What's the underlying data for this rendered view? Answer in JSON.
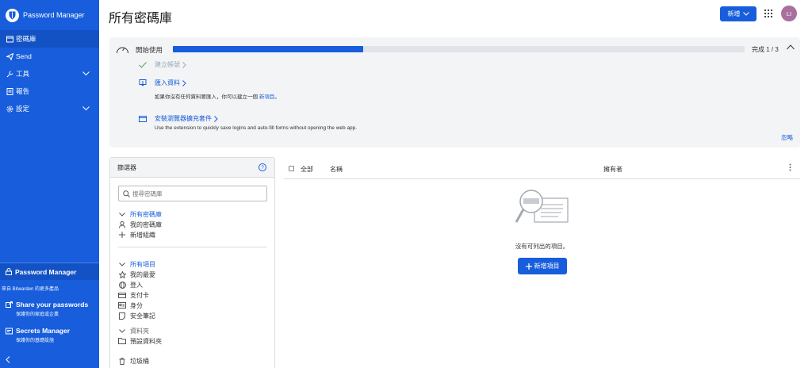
{
  "sidebar": {
    "brand": "Password Manager",
    "nav": [
      {
        "label": "密碼庫",
        "icon": "vault-icon",
        "active": true
      },
      {
        "label": "Send",
        "icon": "send-icon",
        "active": false
      },
      {
        "label": "工具",
        "icon": "wrench-icon",
        "has_children": true
      },
      {
        "label": "報告",
        "icon": "report-icon",
        "active": false
      },
      {
        "label": "設定",
        "icon": "gear-icon",
        "has_children": true
      }
    ],
    "current_product": "Password Manager",
    "more_from": "來自 Bitwarden 的更多產品",
    "products": [
      {
        "title": "Share your passwords",
        "subtitle": "保護你的家庭或企業"
      },
      {
        "title": "Secrets Manager",
        "subtitle": "保護你的基礎設施"
      }
    ]
  },
  "header": {
    "title": "所有密碼庫",
    "new_label": "新增",
    "avatar_initials": "LI"
  },
  "onboarding": {
    "title": "開始使用",
    "progress_fraction": 0.333,
    "progress_text": "完成 1 / 3",
    "tasks": [
      {
        "label": "建立帳號",
        "done": true
      },
      {
        "label": "匯入資料",
        "done": false,
        "description": "如果你沒有任何資料要匯入，你可以建立一個",
        "description_link": "新項目",
        "description_suffix": "。"
      },
      {
        "label": "安裝瀏覽器擴充套件",
        "done": false,
        "description": "Use the extension to quickly save logins and auto-fill forms without opening the web app."
      }
    ],
    "dismiss": "忽略"
  },
  "filter": {
    "title": "篩選器",
    "search_placeholder": "搜尋密碼庫",
    "vaults_header": "所有密碼庫",
    "vaults": [
      "我的密碼庫",
      "新增組織"
    ],
    "items_header": "所有項目",
    "types": [
      "我的最愛",
      "登入",
      "支付卡",
      "身分",
      "安全筆記"
    ],
    "folders_header": "資料夾",
    "folders": [
      "預設資料夾"
    ],
    "trash": "垃圾桶"
  },
  "items": {
    "col_all": "全部",
    "col_name": "名稱",
    "col_owner": "擁有者",
    "empty_text": "沒有可列出的項目。",
    "add_label": "新增項目"
  },
  "colors": {
    "brand": "#175ddc",
    "panel": "#f3f4f6",
    "avatar": "#a96f9e"
  }
}
